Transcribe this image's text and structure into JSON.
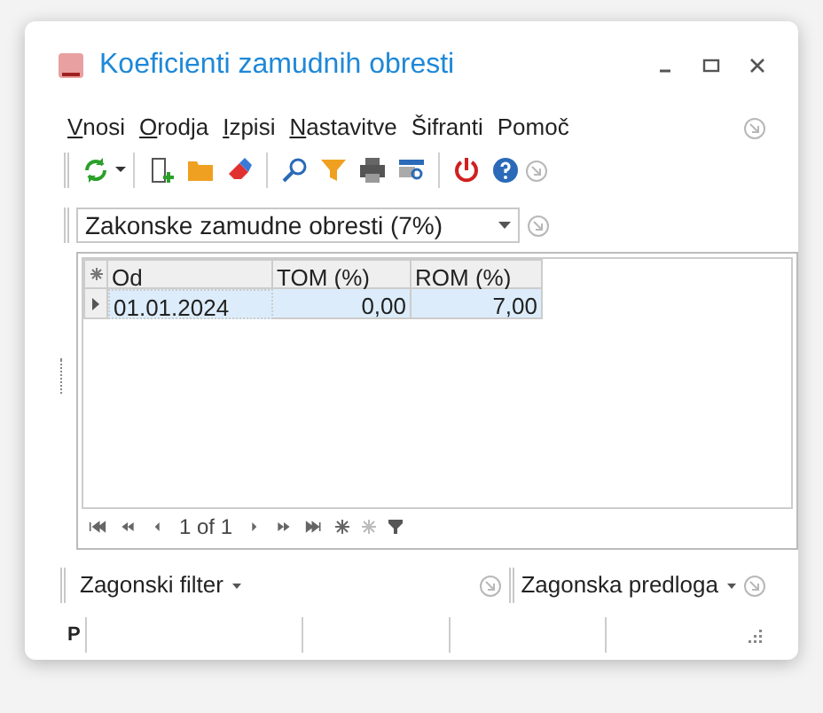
{
  "window": {
    "title": "Koeficienti zamudnih obresti"
  },
  "menu": [
    {
      "label": "Vnosi",
      "underline_first": true
    },
    {
      "label": "Orodja",
      "underline_first": true
    },
    {
      "label": "Izpisi",
      "underline_first": true
    },
    {
      "label": "Nastavitve",
      "underline_first": true
    },
    {
      "label": "Šifranti",
      "underline_first": false
    },
    {
      "label": "Pomoč",
      "underline_first": false
    }
  ],
  "selector": {
    "value": "Zakonske zamudne obresti (7%)"
  },
  "table": {
    "columns": [
      "Od",
      "TOM (%)",
      "ROM (%)"
    ],
    "rows": [
      {
        "cells": [
          "01.01.2024",
          "0,00",
          "7,00"
        ],
        "selected": true
      }
    ]
  },
  "pager": {
    "text": "1 of 1"
  },
  "bottom_toolbar": {
    "filter": "Zagonski filter",
    "template": "Zagonska predloga"
  },
  "status_bar": {
    "label": "P"
  }
}
